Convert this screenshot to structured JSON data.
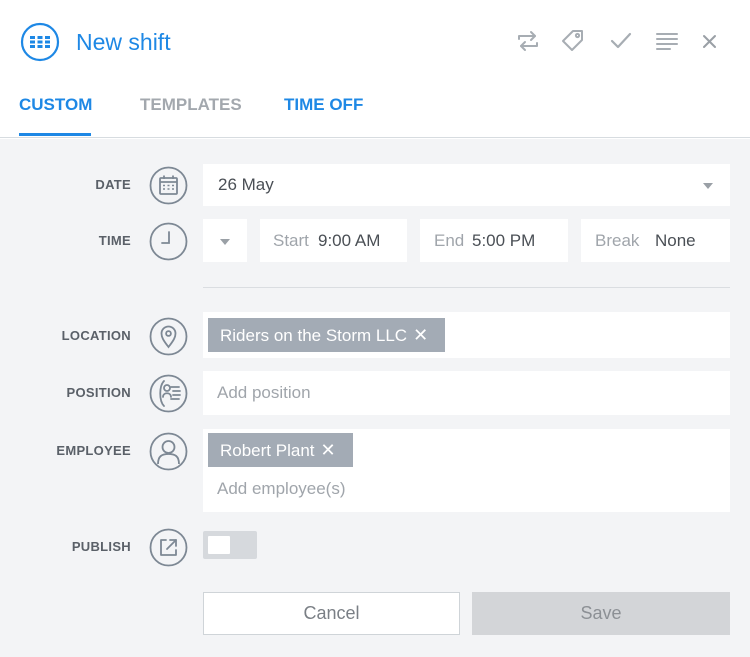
{
  "header": {
    "title": "New shift",
    "icons": [
      "repeat-icon",
      "tag-icon",
      "check-icon",
      "notes-icon",
      "close-icon"
    ]
  },
  "tabs": [
    {
      "label": "CUSTOM",
      "active": true
    },
    {
      "label": "TEMPLATES",
      "active": false
    },
    {
      "label": "TIME OFF",
      "active": false
    }
  ],
  "form": {
    "date": {
      "label": "DATE",
      "value": "26 May"
    },
    "time": {
      "label": "TIME",
      "start_placeholder": "Start",
      "start_value": "9:00 AM",
      "end_placeholder": "End",
      "end_value": "5:00 PM",
      "break_placeholder": "Break",
      "break_value": "None"
    },
    "location": {
      "label": "LOCATION",
      "chip": "Riders on the Storm LLC"
    },
    "position": {
      "label": "POSITION",
      "placeholder": "Add position"
    },
    "employee": {
      "label": "EMPLOYEE",
      "chip": "Robert Plant",
      "placeholder": "Add employee(s)"
    },
    "publish": {
      "label": "PUBLISH",
      "enabled": false
    }
  },
  "buttons": {
    "cancel": "Cancel",
    "save": "Save"
  },
  "colors": {
    "accent": "#1e88e5",
    "inactive_tab": "#a3a8ae",
    "chip": "#a3abb5",
    "icon": "#7d8894"
  },
  "close_glyph": "✕"
}
